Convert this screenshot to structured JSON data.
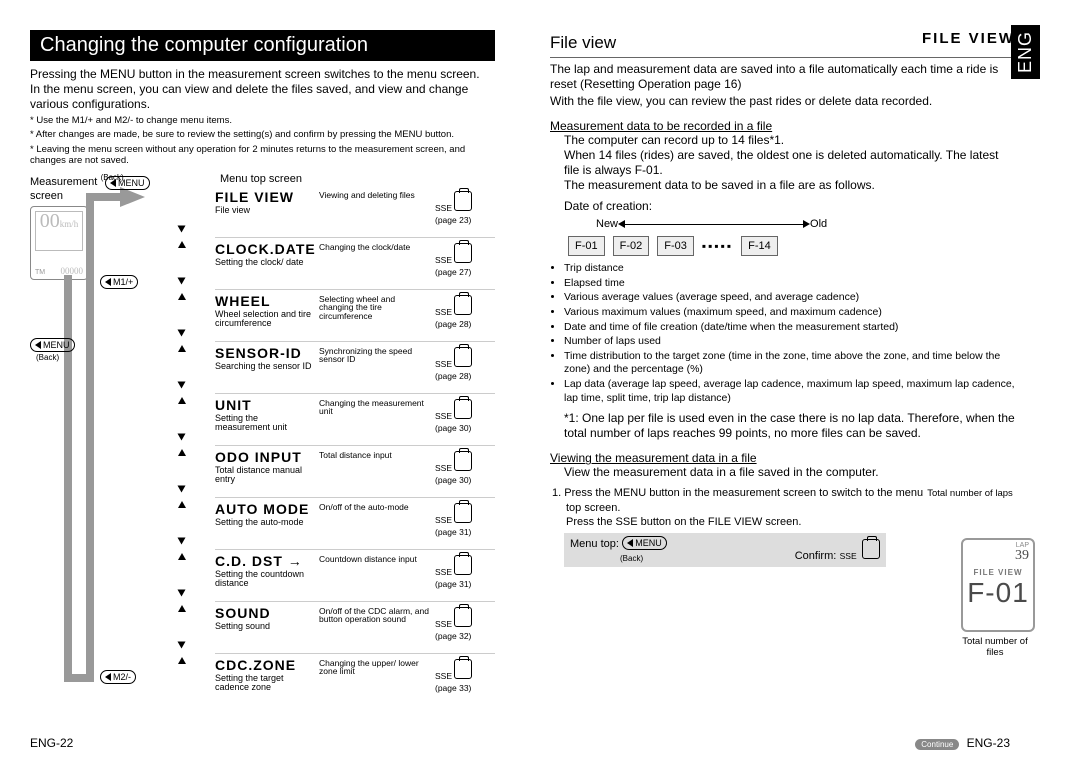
{
  "left": {
    "title": "Changing the computer configuration",
    "intro": "Pressing the MENU button in the measurement screen switches to the menu screen.\nIn the menu screen, you can view and delete the files saved, and view and change various configurations.",
    "fine1": "* Use the M1/+ and M2/- to change menu items.",
    "fine2": "* After changes are made, be sure to review the setting(s) and confirm by pressing the MENU button.",
    "fine3": "* Leaving the menu screen without any operation for 2 minutes returns to the measurement screen, and changes are not saved.",
    "measurement_label": "Measurement",
    "screen_label": "screen",
    "back_hint": "(Back)",
    "menu_top_label": "Menu top screen",
    "rail": {
      "menu1": "MENU",
      "m1": "M1/+",
      "menu2": "MENU",
      "back2": "(Back)",
      "m2": "M2/-"
    },
    "items": [
      {
        "title": "FILE VIEW",
        "sub": "File view",
        "desc": "Viewing and deleting files",
        "btn": "SSE",
        "page": "(page 23)"
      },
      {
        "title": "CLOCK.DATE",
        "sub": "Setting the clock/ date",
        "desc": "Changing the clock/date",
        "btn": "SSE",
        "page": "(page 27)"
      },
      {
        "title": "WHEEL",
        "sub": "Wheel selection and tire circumference",
        "desc": "Selecting wheel and changing the tire circumference",
        "btn": "SSE",
        "page": "(page 28)"
      },
      {
        "title": "SENSOR-ID",
        "sub": "Searching the sensor ID",
        "desc": "Synchronizing the speed sensor ID",
        "btn": "SSE",
        "page": "(page 28)"
      },
      {
        "title": "UNIT",
        "sub": "Setting the measurement unit",
        "desc": "Changing the measurement unit",
        "btn": "SSE",
        "page": "(page 30)"
      },
      {
        "title": "ODO INPUT",
        "sub": "Total distance manual entry",
        "desc": "Total distance input",
        "btn": "SSE",
        "page": "(page 30)"
      },
      {
        "title": "AUTO MODE",
        "sub": "Setting the auto-mode",
        "desc": "On/off of the auto-mode",
        "btn": "SSE",
        "page": "(page 31)"
      },
      {
        "title": "C.D. DST →",
        "sub": "Setting the countdown distance",
        "desc": "Countdown distance input",
        "btn": "SSE",
        "page": "(page 31)"
      },
      {
        "title": "SOUND",
        "sub": "Setting sound",
        "desc": "On/off of the CDC alarm, and button operation sound",
        "btn": "SSE",
        "page": "(page 32)"
      },
      {
        "title": "CDC.ZONE",
        "sub": "Setting the target cadence zone",
        "desc": "Changing the upper/ lower zone limit",
        "btn": "SSE",
        "page": "(page 33)"
      }
    ],
    "footer": "ENG-22"
  },
  "right": {
    "side_tab": "ENG",
    "h1": "File view",
    "lcd_title": "FILE VIEW",
    "intro1": "The lap and measurement data are saved into a file automatically each time a ride is reset (Resetting Operation page 16)",
    "intro2": "With the file view, you can review the past rides or delete data recorded.",
    "subh1": "Measurement data to be recorded in a file",
    "p1": "The computer can record up to 14 files*1.",
    "p2": "When 14 files (rides) are saved, the oldest one is deleted automatically. The latest file is always F-01.",
    "p3": "The measurement data to be saved in a file are as follows.",
    "date_lbl": "Date of creation:",
    "new_lbl": "New",
    "old_lbl": "Old",
    "files": [
      "F-01",
      "F-02",
      "F-03",
      "F-14"
    ],
    "bullets": [
      "Trip distance",
      "Elapsed time",
      "Various average values (average speed, and average cadence)",
      "Various maximum values (maximum speed, and maximum cadence)",
      "Date and time of file creation (date/time when the measurement started)",
      "Number of laps used",
      "Time distribution to the target zone (time in the zone, time above the zone, and time below the zone) and the percentage (%)",
      "Lap data (average lap speed, average lap cadence, maximum lap speed, maximum lap cadence, lap time, split time, trip lap distance)"
    ],
    "note1": "*1: One lap per file is used even in the case there is no lap data. Therefore, when the total number of laps reaches 99 points, no more files can be saved.",
    "subh2": "Viewing the measurement data in a file",
    "p4": "View the measurement data in a file saved in the computer.",
    "step1a": "1. Press the MENU button in the measurement screen to switch to the menu top screen.",
    "step1b": "Press the SSE button on the FILE VIEW screen.",
    "menu_top_lbl": "Menu top:",
    "menu_btn_lbl": "MENU",
    "menu_back_lbl": "(Back)",
    "confirm_lbl": "Confirm:",
    "confirm_btn": "SSE",
    "device": {
      "lap_lbl": "LAP",
      "lap_num": "39",
      "fv": "FILE VIEW",
      "file": "F-01"
    },
    "cap_top": "Total number of laps",
    "cap_bot": "Total number of files",
    "continue": "Continue",
    "footer": "ENG-23"
  }
}
